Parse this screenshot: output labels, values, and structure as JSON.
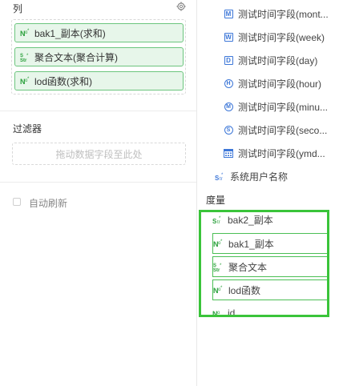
{
  "columns": {
    "title": "列",
    "items": [
      {
        "label": "bak1_副本(求和)",
        "icon": "number-type-icon"
      },
      {
        "label": "聚合文本(聚合计算)",
        "icon": "string-type-icon"
      },
      {
        "label": "lod函数(求和)",
        "icon": "number-type-icon"
      }
    ]
  },
  "filter": {
    "title": "过滤器",
    "placeholder": "拖动数据字段至此处"
  },
  "auto_refresh": {
    "label": "自动刷新",
    "checked": false
  },
  "dimensions": {
    "items": [
      {
        "label": "测试时间字段(mont...",
        "badge": "M"
      },
      {
        "label": "测试时间字段(week)",
        "badge": "W"
      },
      {
        "label": "测试时间字段(day)",
        "badge": "D"
      },
      {
        "label": "测试时间字段(hour)",
        "badge": "H"
      },
      {
        "label": "测试时间字段(minu...",
        "badge": "M"
      },
      {
        "label": "测试时间字段(seco...",
        "badge": "S"
      },
      {
        "label": "测试时间字段(ymd...",
        "badge": "calendar"
      },
      {
        "label": "系统用户名称",
        "badge": "Str"
      }
    ]
  },
  "measures": {
    "title": "度量",
    "items": [
      {
        "label": "bak2_副本"
      },
      {
        "label": "bak1_副本"
      },
      {
        "label": "聚合文本"
      },
      {
        "label": "lod函数"
      },
      {
        "label": "id"
      }
    ]
  },
  "colors": {
    "pill_bg": "#e7f6ea",
    "pill_border": "#6cc57e",
    "field_blue": "#3d77d8",
    "type_green": "#2aa03b",
    "highlight_green": "#3ac43a"
  }
}
